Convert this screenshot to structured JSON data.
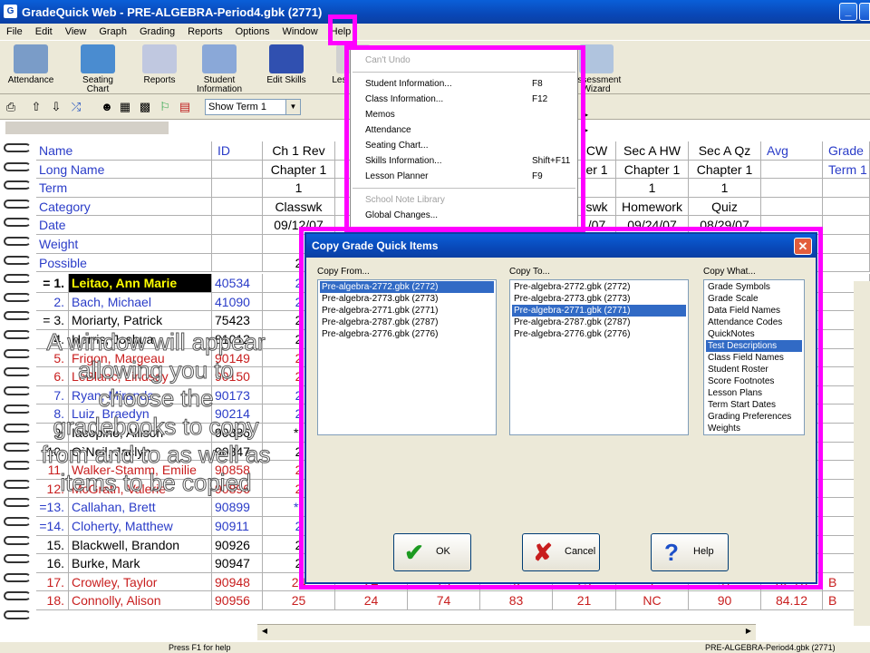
{
  "window": {
    "title": "GradeQuick Web - PRE-ALGEBRA-Period4.gbk (2771)"
  },
  "menubar": [
    "File",
    "Edit",
    "View",
    "Graph",
    "Grading",
    "Reports",
    "Options",
    "Window",
    "Help"
  ],
  "toolbar": [
    {
      "label": "Attendance",
      "icon": "attendance-icon"
    },
    {
      "label": "Seating Chart",
      "icon": "seating-chart-icon"
    },
    {
      "label": "Reports",
      "icon": "reports-icon"
    },
    {
      "label": "Student Information",
      "icon": "student-info-icon"
    },
    {
      "label": "Edit Skills",
      "icon": "edit-skills-icon"
    },
    {
      "label": "Les... Plan",
      "icon": "lesson-planner-icon"
    },
    {
      "label": "Assessment Wizard",
      "icon": "assessment-wizard-icon"
    }
  ],
  "term_select": {
    "value": "Show Term 1"
  },
  "grid": {
    "header_rows": [
      {
        "label": "Name",
        "cols": [
          "ID",
          "Ch 1 Rev",
          "C",
          "CW",
          "Sec A HW",
          "Sec A Qz",
          "Avg",
          "Grade"
        ]
      },
      {
        "label": "Long Name",
        "cols": [
          "",
          "Chapter 1",
          "C",
          "er 1",
          "Chapter 1",
          "Chapter 1",
          "",
          "Term 1"
        ]
      },
      {
        "label": "Term",
        "cols": [
          "",
          "1",
          "",
          "",
          "1",
          "1",
          "",
          ""
        ]
      },
      {
        "label": "Category",
        "cols": [
          "",
          "Classwk",
          "C",
          "swk",
          "Homework",
          "Quiz",
          "",
          ""
        ]
      },
      {
        "label": "Date",
        "cols": [
          "",
          "09/12/07",
          "",
          "/07",
          "09/24/07",
          "08/29/07",
          "",
          ""
        ]
      },
      {
        "label": "Weight",
        "cols": [
          "",
          "",
          "",
          "",
          "",
          "",
          "",
          ""
        ]
      },
      {
        "label": "Possible",
        "cols": [
          "",
          "2",
          "",
          "",
          "",
          "",
          "",
          ""
        ]
      }
    ],
    "students": [
      {
        "num": "= 1.",
        "name": "Leitao, Ann Marie",
        "id": "40534",
        "c1": "2",
        "color": "blue",
        "highlight": true
      },
      {
        "num": "2.",
        "name": "Bach, Michael",
        "id": "41090",
        "c1": "2",
        "color": "blue"
      },
      {
        "num": "= 3.",
        "name": "Moriarty, Patrick",
        "id": "75423",
        "c1": "2",
        "color": "black"
      },
      {
        "num": "4.",
        "name": "Harris, Joshua",
        "id": "81012",
        "c1": "2",
        "color": "black"
      },
      {
        "num": "5.",
        "name": "Frigon, Margeau",
        "id": "90149",
        "c1": "2",
        "color": "red"
      },
      {
        "num": "6.",
        "name": "LeBlanc, Lindsay",
        "id": "90150",
        "c1": "2",
        "color": "red"
      },
      {
        "num": "7.",
        "name": "Ryan, Miranda",
        "id": "90173",
        "c1": "2",
        "color": "blue"
      },
      {
        "num": "8.",
        "name": "Luiz, Braedyn",
        "id": "90214",
        "c1": "2",
        "color": "blue"
      },
      {
        "num": "9.",
        "name": "Iacopino, Allison",
        "id": "90886",
        "c1": "**",
        "color": "black"
      },
      {
        "num": "10.",
        "name": "O`Neil, Jaclyn",
        "id": "90847",
        "c1": "2",
        "color": "black"
      },
      {
        "num": "11.",
        "name": "Walker-Stamm, Emilie",
        "id": "90858",
        "c1": "2",
        "color": "red"
      },
      {
        "num": "12.",
        "name": "McGrath, Valerie",
        "id": "90896",
        "c1": "2",
        "color": "red"
      },
      {
        "num": "=13.",
        "name": "Callahan, Brett",
        "id": "90899",
        "c1": "**",
        "color": "blue"
      },
      {
        "num": "=14.",
        "name": "Cloherty, Matthew",
        "id": "90911",
        "c1": "2",
        "color": "blue"
      },
      {
        "num": "15.",
        "name": "Blackwell, Brandon",
        "id": "90926",
        "c1": "2",
        "color": "black"
      },
      {
        "num": "16.",
        "name": "Burke, Mark",
        "id": "90947",
        "c1": "2",
        "color": "black"
      },
      {
        "num": "17.",
        "name": "Crowley, Taylor",
        "id": "90948",
        "c1": "24",
        "cols": [
          "24",
          "79",
          "92",
          "25",
          "Y",
          "91",
          "82.76",
          "B"
        ],
        "color": "red"
      },
      {
        "num": "18.",
        "name": "Connolly, Alison",
        "id": "90956",
        "c1": "25",
        "cols": [
          "24",
          "74",
          "83",
          "21",
          "NC",
          "90",
          "84.12",
          "B"
        ],
        "color": "red"
      }
    ]
  },
  "context_menu": {
    "items": [
      {
        "label": "Can't Undo",
        "shortcut": "",
        "disabled": true
      },
      {
        "sep": true
      },
      {
        "label": "Student Information...",
        "shortcut": "F8"
      },
      {
        "label": "Class Information...",
        "shortcut": "F12"
      },
      {
        "label": "Memos",
        "shortcut": "",
        "submenu": true
      },
      {
        "label": "Attendance",
        "shortcut": "",
        "submenu": true
      },
      {
        "label": "Seating Chart...",
        "shortcut": ""
      },
      {
        "label": "Skills Information...",
        "shortcut": "Shift+F11"
      },
      {
        "label": "Lesson Planner",
        "shortcut": "F9"
      },
      {
        "sep": true
      },
      {
        "label": "School Note Library",
        "shortcut": "",
        "disabled": true
      },
      {
        "label": "Global Changes...",
        "shortcut": ""
      }
    ]
  },
  "dialog": {
    "title": "Copy Grade Quick Items",
    "copy_from_label": "Copy From...",
    "copy_to_label": "Copy To...",
    "copy_what_label": "Copy What...",
    "copy_from": [
      "Pre-algebra-2772.gbk (2772)",
      "Pre-algebra-2773.gbk (2773)",
      "Pre-algebra-2771.gbk (2771)",
      "Pre-algebra-2787.gbk (2787)",
      "Pre-algebra-2776.gbk (2776)"
    ],
    "copy_from_selected": 0,
    "copy_to": [
      "Pre-algebra-2772.gbk (2772)",
      "Pre-algebra-2773.gbk (2773)",
      "Pre-algebra-2771.gbk (2771)",
      "Pre-algebra-2787.gbk (2787)",
      "Pre-algebra-2776.gbk (2776)"
    ],
    "copy_to_selected": 2,
    "copy_what": [
      "Grade Symbols",
      "Grade Scale",
      "Data Field Names",
      "Attendance Codes",
      "QuickNotes",
      "Test Descriptions",
      "Class Field Names",
      "Student Roster",
      "Score Footnotes",
      "Lesson Plans",
      "Term Start Dates",
      "Grading Preferences",
      "Weights"
    ],
    "copy_what_selected": 5,
    "ok_label": "OK",
    "cancel_label": "Cancel",
    "help_label": "Help"
  },
  "overlay_text": "A window will appear allowing you to choose the gradebooks to copy from and to as well as items to be copied",
  "statusbar": {
    "left": "Press F1 for help",
    "right": "PRE-ALGEBRA-Period4.gbk (2771)"
  }
}
